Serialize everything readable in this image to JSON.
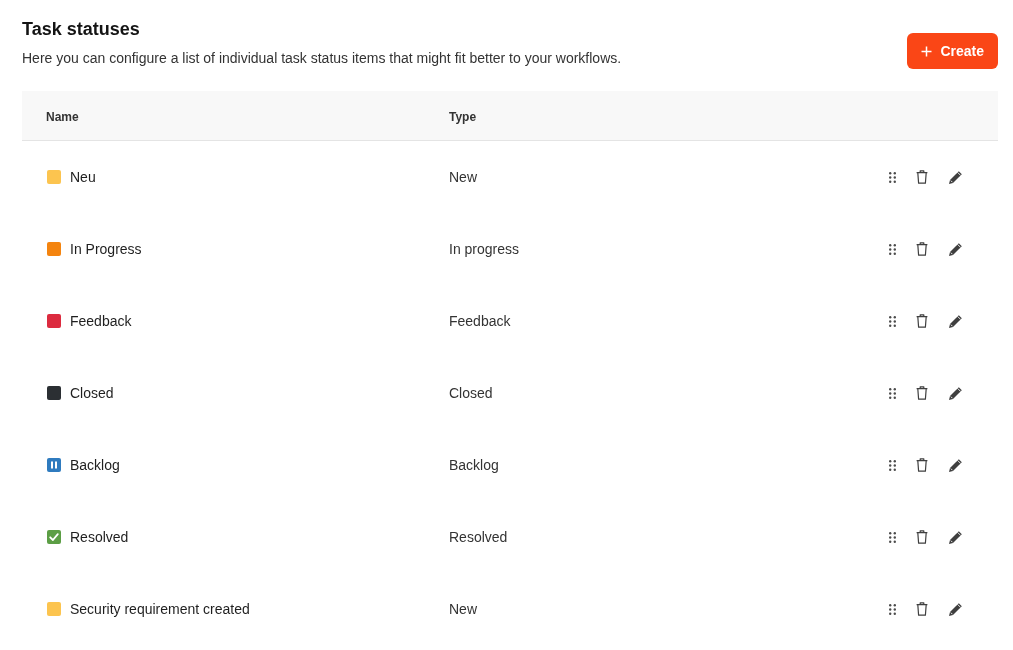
{
  "header": {
    "title": "Task statuses",
    "description": "Here you can configure a list of individual task status items that might fit better to your workflows.",
    "create_button": {
      "label": "Create"
    }
  },
  "table": {
    "columns": [
      "Name",
      "Type"
    ],
    "rows": [
      {
        "name": "Neu",
        "type": "New",
        "status_icon": {
          "kind": "square",
          "color": "#fcc44f"
        }
      },
      {
        "name": "In Progress",
        "type": "In progress",
        "status_icon": {
          "kind": "square",
          "color": "#f4840f"
        }
      },
      {
        "name": "Feedback",
        "type": "Feedback",
        "status_icon": {
          "kind": "square",
          "color": "#dc2b3f"
        }
      },
      {
        "name": "Closed",
        "type": "Closed",
        "status_icon": {
          "kind": "square",
          "color": "#2b2f33"
        }
      },
      {
        "name": "Backlog",
        "type": "Backlog",
        "status_icon": {
          "kind": "pause",
          "color": "#2f7bbf"
        }
      },
      {
        "name": "Resolved",
        "type": "Resolved",
        "status_icon": {
          "kind": "check",
          "color": "#5c9e45"
        }
      },
      {
        "name": "Security requirement created",
        "type": "New",
        "status_icon": {
          "kind": "square",
          "color": "#fcc44f"
        }
      }
    ]
  }
}
